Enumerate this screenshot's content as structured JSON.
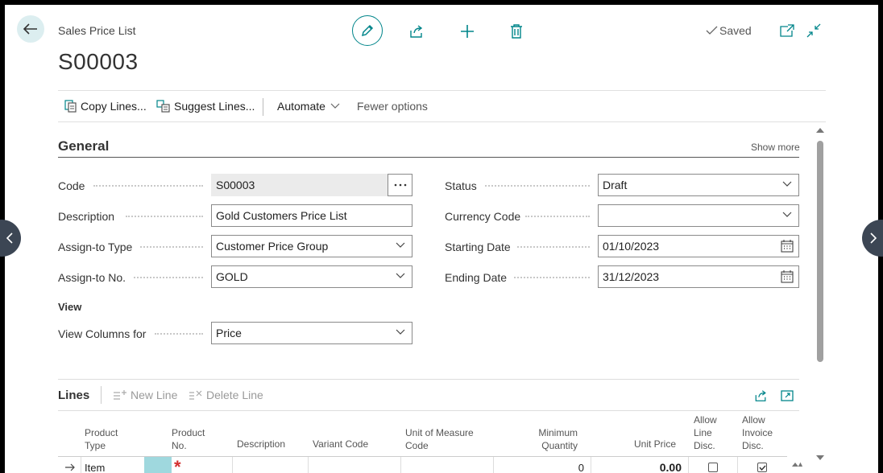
{
  "header": {
    "breadcrumb": "Sales Price List",
    "title": "S00003",
    "saved_label": "Saved"
  },
  "actions": {
    "copy_lines": "Copy Lines...",
    "suggest_lines": "Suggest Lines...",
    "automate": "Automate",
    "fewer_options": "Fewer options"
  },
  "general": {
    "title": "General",
    "show_more": "Show more",
    "code": {
      "label": "Code",
      "value": "S00003"
    },
    "description": {
      "label": "Description",
      "value": "Gold Customers Price List"
    },
    "assign_to_type": {
      "label": "Assign-to Type",
      "value": "Customer Price Group"
    },
    "assign_to_no": {
      "label": "Assign-to No.",
      "value": "GOLD"
    },
    "view_heading": "View",
    "view_columns_for": {
      "label": "View Columns for",
      "value": "Price"
    },
    "status": {
      "label": "Status",
      "value": "Draft"
    },
    "currency_code": {
      "label": "Currency Code",
      "value": ""
    },
    "starting_date": {
      "label": "Starting Date",
      "value": "01/10/2023"
    },
    "ending_date": {
      "label": "Ending Date",
      "value": "31/12/2023"
    }
  },
  "lines": {
    "title": "Lines",
    "new_line": "New Line",
    "delete_line": "Delete Line",
    "columns": {
      "product_type": [
        "Product",
        "Type"
      ],
      "product_no": [
        "Product",
        "No."
      ],
      "description": "Description",
      "variant_code": "Variant Code",
      "uom_code": [
        "Unit of Measure",
        "Code"
      ],
      "min_qty": [
        "Minimum",
        "Quantity"
      ],
      "unit_price": "Unit Price",
      "allow_line_disc": [
        "Allow",
        "Line",
        "Disc."
      ],
      "allow_invoice_disc": [
        "Allow",
        "Invoice",
        "Disc."
      ]
    },
    "row": {
      "product_type": "Item",
      "required_marker": "*",
      "min_qty": "0",
      "unit_price": "0.00"
    }
  },
  "colors": {
    "accent": "#00858a",
    "back_button_bg": "#dceef0",
    "selected_cell": "#9fd8de",
    "required": "#d32f2f"
  }
}
